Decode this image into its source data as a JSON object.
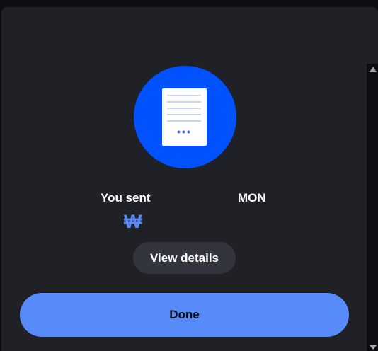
{
  "transaction": {
    "icon": "document-icon",
    "sent_label": "You sent",
    "ticker": "MON",
    "currency_symbol": "₩",
    "doc_dots": "•••"
  },
  "actions": {
    "view_details_label": "View details",
    "done_label": "Done"
  },
  "colors": {
    "panel_bg": "#202127",
    "accent_blue": "#0052ff",
    "button_blue": "#578bfa",
    "secondary_button": "#32353d"
  }
}
